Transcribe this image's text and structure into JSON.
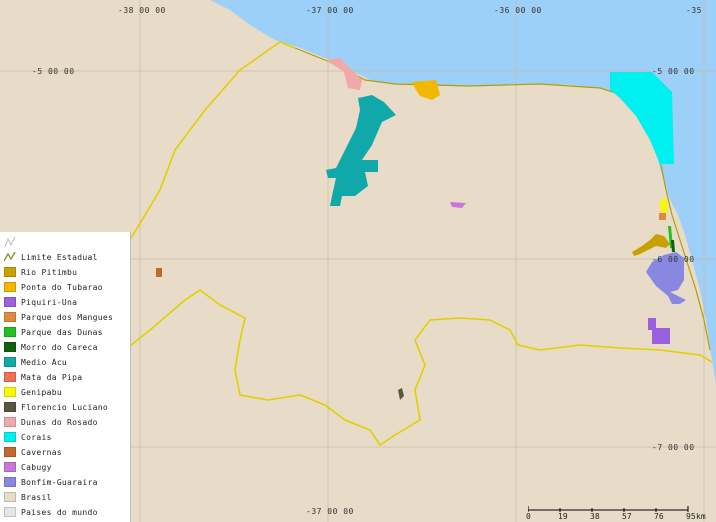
{
  "coords": {
    "top": [
      "-38 00 00",
      "-37 00 00",
      "-36 00 00",
      "-35"
    ],
    "bottom": [
      "-37 00 00"
    ],
    "right": [
      "-5 00 00",
      "-6 00 00",
      "-7 00 00"
    ],
    "left": [
      "-5 00 00"
    ]
  },
  "legend": [
    {
      "label": "Limite Estadual",
      "color": "#d8d000",
      "icon": "line-icon"
    },
    {
      "label": "Rio Pitimbu",
      "color": "#c8a000"
    },
    {
      "label": "Ponta do Tubarao",
      "color": "#f0b800"
    },
    {
      "label": "Piquiri-Una",
      "color": "#9a60e0"
    },
    {
      "label": "Parque dos Mangues",
      "color": "#e08a40"
    },
    {
      "label": "Parque das Dunas",
      "color": "#22c022"
    },
    {
      "label": "Morro do Careca",
      "color": "#106010"
    },
    {
      "label": "Medio Acu",
      "color": "#10a8a8"
    },
    {
      "label": "Mata da Pipa",
      "color": "#f07050"
    },
    {
      "label": "Genipabu",
      "color": "#f8f800"
    },
    {
      "label": "Florencio Luciano",
      "color": "#585840"
    },
    {
      "label": "Dunas do Rosado",
      "color": "#f0a8a8"
    },
    {
      "label": "Corais",
      "color": "#00f0f0"
    },
    {
      "label": "Cavernas",
      "color": "#c06830"
    },
    {
      "label": "Cabugy",
      "color": "#c878d8"
    },
    {
      "label": "Bonfim-Guaraira",
      "color": "#8888e0"
    },
    {
      "label": "Brasil",
      "color": "#e8dcc8"
    },
    {
      "label": "Paises do mundo",
      "color": "#e6e6e6"
    }
  ],
  "scale": {
    "ticks": [
      "0",
      "19",
      "38",
      "57",
      "76",
      "95"
    ],
    "unit": "km"
  }
}
